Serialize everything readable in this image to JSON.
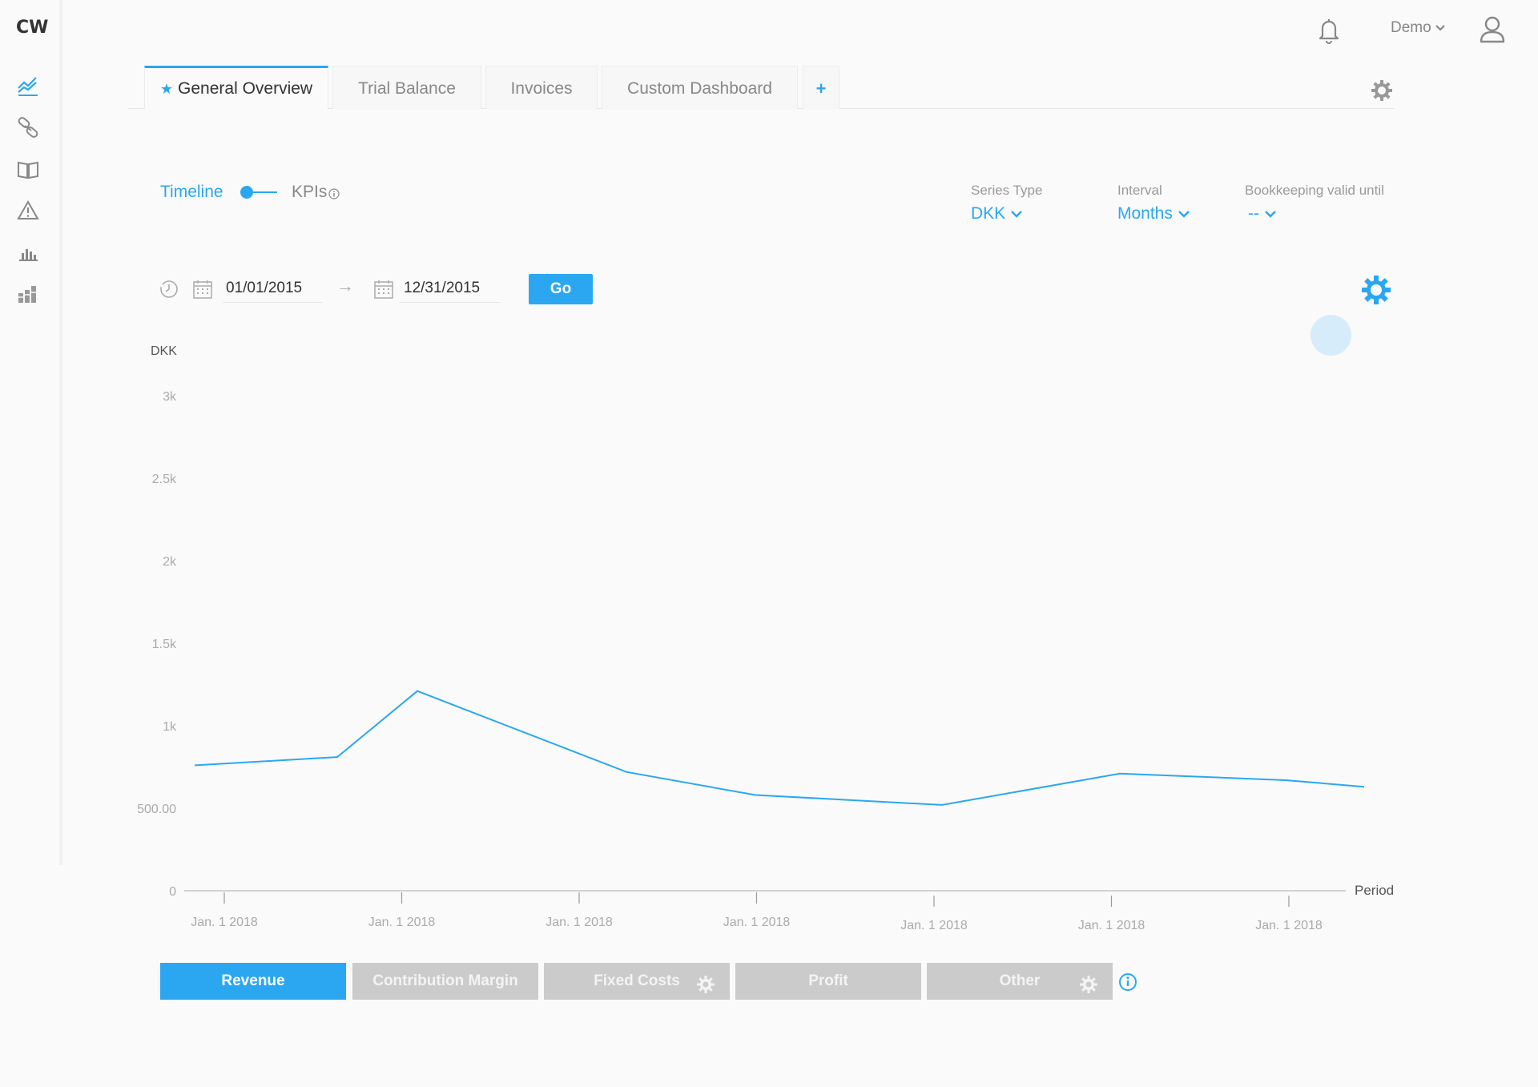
{
  "app": {
    "logo": "CW"
  },
  "sidebar": {
    "items": [
      {
        "icon": "line-chart-icon",
        "active": true
      },
      {
        "icon": "link-icon"
      },
      {
        "icon": "book-icon"
      },
      {
        "icon": "warning-icon"
      },
      {
        "icon": "bar-chart-icon"
      },
      {
        "icon": "stacked-bar-icon"
      }
    ]
  },
  "topbar": {
    "user_menu_label": "Demo"
  },
  "tabs": [
    {
      "label": "General Overview",
      "active": true,
      "starred": true
    },
    {
      "label": "Trial Balance"
    },
    {
      "label": "Invoices"
    },
    {
      "label": "Custom Dashboard"
    },
    {
      "label": "+"
    }
  ],
  "view_toggle": {
    "timeline_label": "Timeline",
    "kpis_label": "KPIs",
    "mode": "Timeline"
  },
  "selectors": {
    "series_type": {
      "label": "Series Type",
      "value": "DKK"
    },
    "interval": {
      "label": "Interval",
      "value": "Months"
    },
    "bookkeeping": {
      "label": "Bookkeeping valid until",
      "value": "--"
    }
  },
  "date_range": {
    "from": "01/01/2015",
    "to": "12/31/2015",
    "arrow": "→",
    "go_label": "Go"
  },
  "chart_data": {
    "type": "line",
    "ylabel": "DKK",
    "xlabel": "Period",
    "yticks": [
      "0",
      "500.00",
      "1k",
      "1.5k",
      "2k",
      "2.5k",
      "3k"
    ],
    "ylim": [
      0,
      3000
    ],
    "xtick_labels": [
      "Jan. 1 2018",
      "Jan. 1 2018",
      "Jan. 1 2018",
      "Jan. 1 2018",
      "Jan. 1 2018",
      "Jan. 1 2018",
      "Jan. 1 2018"
    ],
    "grid": false,
    "series": [
      {
        "color": "#2aa7f0",
        "values": [
          760,
          810,
          1210,
          720,
          580,
          520,
          710,
          670,
          630
        ]
      }
    ]
  },
  "series_buttons": [
    {
      "label": "Revenue",
      "active": true
    },
    {
      "label": "Contribution Margin"
    },
    {
      "label": "Fixed Costs",
      "has_gear": true
    },
    {
      "label": "Profit"
    },
    {
      "label": "Other",
      "has_gear": true
    }
  ],
  "colors": {
    "accent": "#2aa7f0",
    "inactive_button": "#cbcbcb"
  }
}
